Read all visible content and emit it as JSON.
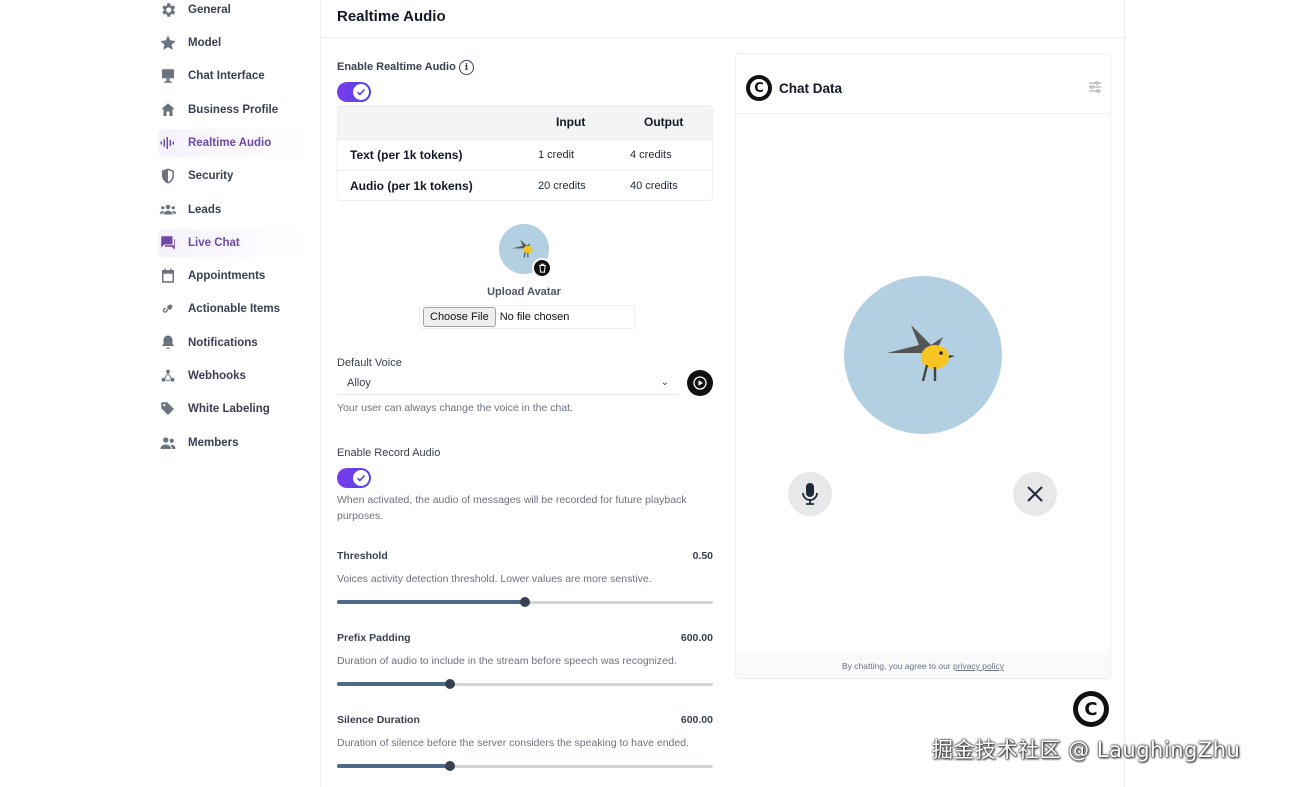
{
  "sidebar": {
    "items": [
      {
        "label": "General",
        "icon": "gear-icon"
      },
      {
        "label": "Model",
        "icon": "star-icon"
      },
      {
        "label": "Chat Interface",
        "icon": "monitor-icon"
      },
      {
        "label": "Business Profile",
        "icon": "home-icon"
      },
      {
        "label": "Realtime Audio",
        "icon": "soundwave-icon",
        "active": true
      },
      {
        "label": "Security",
        "icon": "shield-icon"
      },
      {
        "label": "Leads",
        "icon": "group-icon"
      },
      {
        "label": "Live Chat",
        "icon": "chat-bubble-icon",
        "active": true
      },
      {
        "label": "Appointments",
        "icon": "calendar-icon"
      },
      {
        "label": "Actionable Items",
        "icon": "link-icon"
      },
      {
        "label": "Notifications",
        "icon": "bell-icon"
      },
      {
        "label": "Webhooks",
        "icon": "webhook-icon"
      },
      {
        "label": "White Labeling",
        "icon": "tags-icon"
      },
      {
        "label": "Members",
        "icon": "people-icon"
      }
    ]
  },
  "header": {
    "title": "Realtime Audio"
  },
  "settings": {
    "enable_realtime_label": "Enable Realtime Audio",
    "pricing": {
      "headers": [
        "Input",
        "Output"
      ],
      "rows": [
        {
          "label": "Text (per 1k tokens)",
          "input": "1 credit",
          "output": "4 credits"
        },
        {
          "label": "Audio (per 1k tokens)",
          "input": "20 credits",
          "output": "40 credits"
        }
      ]
    },
    "upload_avatar_label": "Upload Avatar",
    "file_button": "Choose File",
    "file_status": "No file chosen",
    "default_voice_label": "Default Voice",
    "default_voice_value": "Alloy",
    "default_voice_help": "Your user can always change the voice in the chat.",
    "enable_record_label": "Enable Record Audio",
    "enable_record_help": "When activated, the audio of messages will be recorded for future playback purposes.",
    "threshold": {
      "label": "Threshold",
      "value": "0.50",
      "help": "Voices activity detection threshold. Lower values are more senstive.",
      "fraction": 0.5
    },
    "prefix_padding": {
      "label": "Prefix Padding",
      "value": "600.00",
      "help": "Duration of audio to include in the stream before speech was recognized.",
      "fraction": 0.3
    },
    "silence_duration": {
      "label": "Silence Duration",
      "value": "600.00",
      "help": "Duration of silence before the server considers the speaking to have ended.",
      "fraction": 0.3
    }
  },
  "chat_preview": {
    "title": "Chat Data",
    "logo_letter": "C",
    "footer_text": "By chatting, you agree to our ",
    "footer_link": "privacy policy"
  },
  "floating_logo_letter": "C",
  "watermark": "掘金技术社区 @ LaughingZhu",
  "colors": {
    "accent": "#6d4aa6",
    "toggle": "#6d4aa6",
    "slider_fill": "#4b6a8a",
    "avatar_bg": "#b2d0e2"
  }
}
